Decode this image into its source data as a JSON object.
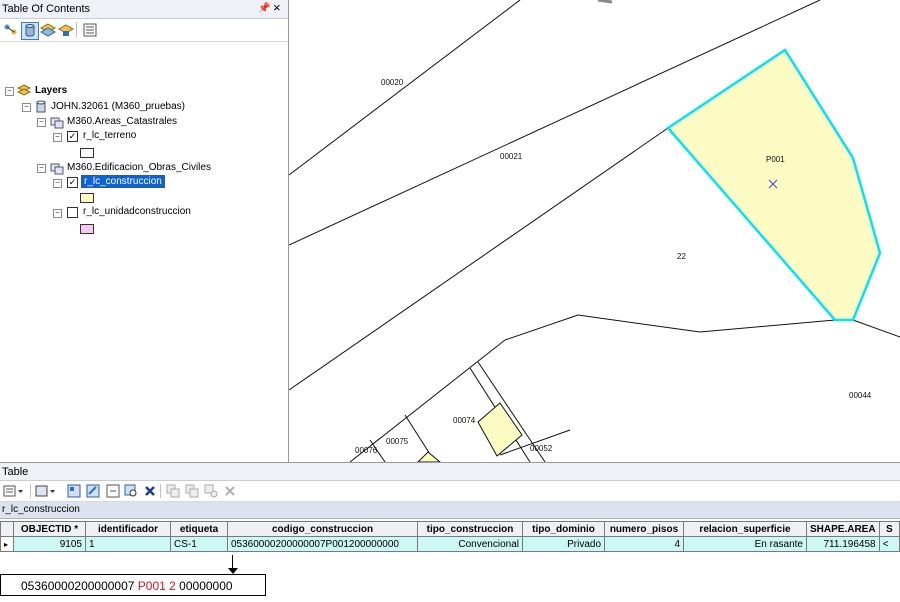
{
  "toc": {
    "title": "Table Of Contents",
    "pin_glyph": "↕",
    "close_glyph": "×",
    "tools": [
      "list-by-drawing-order-icon",
      "list-by-source-icon",
      "list-by-visibility-icon",
      "list-by-selection-icon",
      "options-icon"
    ],
    "tree": {
      "root_label": "Layers",
      "connection_label": "JOHN.32061 (M360_pruebas)",
      "groups": [
        {
          "label": "M360.Areas_Catastrales",
          "layers": [
            {
              "label": "r_lc_terreno",
              "checked": true,
              "swatch": "#ffffff"
            }
          ]
        },
        {
          "label": "M360.Edificacion_Obras_Civiles",
          "layers": [
            {
              "label": "r_lc_construccion",
              "checked": true,
              "selected": true,
              "swatch": "#fefcc4"
            },
            {
              "label": "r_lc_unidadconstruccion",
              "checked": false,
              "swatch": "#f4c8f0"
            }
          ]
        }
      ]
    }
  },
  "map": {
    "labels": [
      "00020",
      "00021",
      "P001",
      "22",
      "00044",
      "00074",
      "00075",
      "00076",
      "00052"
    ],
    "selected_fill": "#fdfbc4",
    "selected_stroke": "#00e5f5"
  },
  "table": {
    "title": "Table",
    "tab_label": "r_lc_construccion",
    "columns": [
      "OBJECTID *",
      "identificador",
      "etiqueta",
      "codigo_construccion",
      "tipo_construccion",
      "tipo_dominio",
      "numero_pisos",
      "relacion_superficie",
      "SHAPE.AREA",
      "S"
    ],
    "rows": [
      [
        "9105",
        "1",
        "CS-1",
        "05360000200000007P001200000000",
        "Convencional",
        "Privado",
        "4",
        "En rasante",
        "711.196458",
        "<"
      ]
    ],
    "row_color": "#cdf7f4"
  },
  "annotation": {
    "part1": "05360000200000007 ",
    "part2": "P001 2",
    "part3": " 00000000",
    "highlight_color": "#e0121c"
  }
}
